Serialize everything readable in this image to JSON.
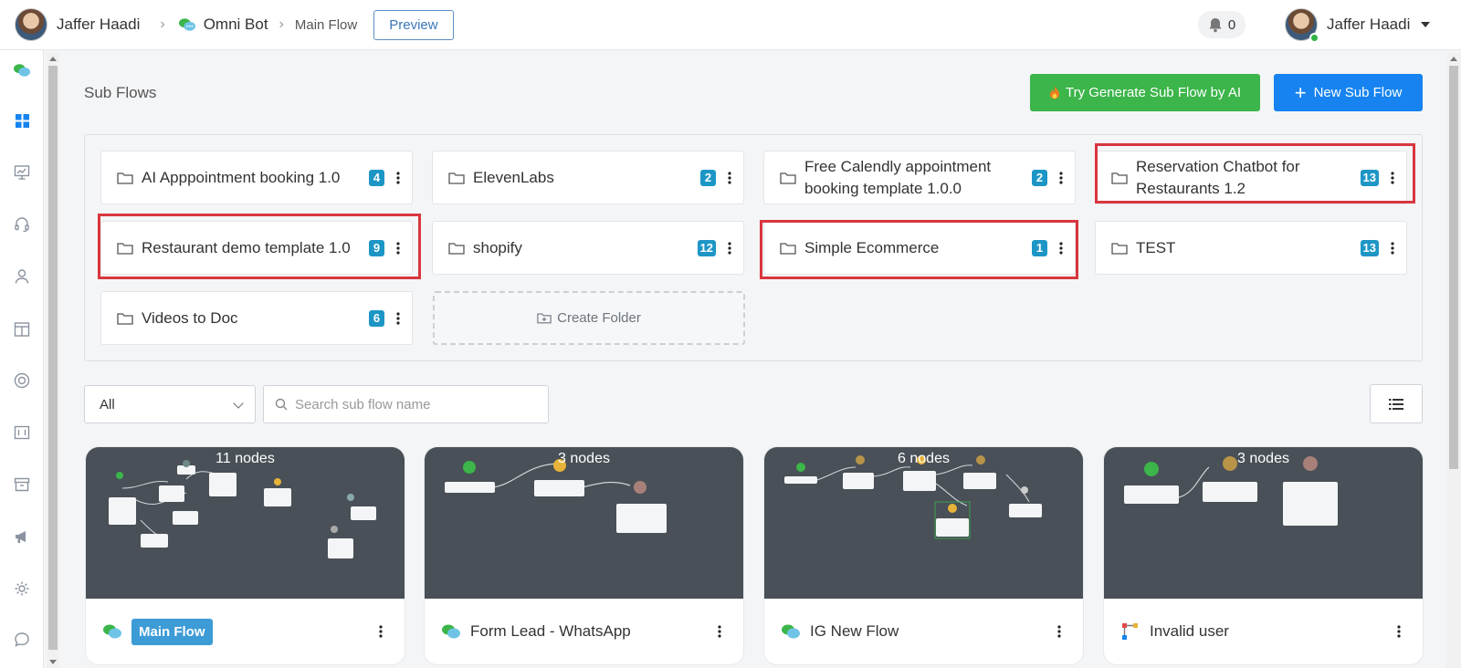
{
  "topbar": {
    "workspace_name": "Jaffer Haadi",
    "bot_name": "Omni Bot",
    "flow_name": "Main Flow",
    "preview_label": "Preview",
    "notification_count": "0",
    "user_name": "Jaffer Haadi"
  },
  "subflows": {
    "title": "Sub Flows",
    "ai_button_label": "Try Generate Sub Flow by AI",
    "new_button_label": "New Sub Flow",
    "create_folder_label": "Create Folder"
  },
  "folders": [
    {
      "name": "AI Apppointment booking 1.0",
      "count": "4"
    },
    {
      "name": "ElevenLabs",
      "count": "2"
    },
    {
      "name": "Free Calendly appointment booking template 1.0.0",
      "count": "2"
    },
    {
      "name": "Reservation Chatbot for Restaurants 1.2",
      "count": "13"
    },
    {
      "name": "Restaurant demo template 1.0",
      "count": "9"
    },
    {
      "name": "shopify",
      "count": "12"
    },
    {
      "name": "Simple Ecommerce",
      "count": "1"
    },
    {
      "name": "TEST",
      "count": "13"
    },
    {
      "name": "Videos to Doc",
      "count": "6"
    }
  ],
  "filters": {
    "selected": "All",
    "search_placeholder": "Search sub flow name"
  },
  "flows": [
    {
      "nodes": "11 nodes",
      "name": "Main Flow",
      "icon": "chat-bubbles-icon"
    },
    {
      "nodes": "3 nodes",
      "name": "Form Lead - WhatsApp",
      "icon": "chat-bubbles-icon"
    },
    {
      "nodes": "6 nodes",
      "name": "IG New Flow",
      "icon": "chat-bubbles-icon"
    },
    {
      "nodes": "3 nodes",
      "name": "Invalid user",
      "icon": "flow-diagram-icon"
    }
  ],
  "colors": {
    "primary": "#1683f0",
    "ai_green": "#3cb54a",
    "badge": "#1d96c6",
    "highlight": "#d9363e",
    "card_preview": "#495057",
    "tag": "#3d9bd6"
  }
}
